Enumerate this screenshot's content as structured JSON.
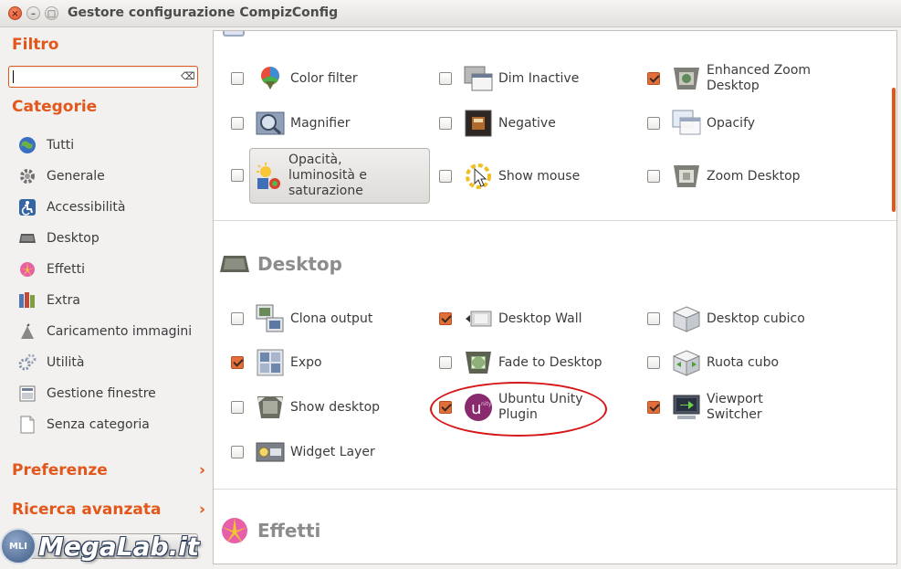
{
  "window": {
    "title": "Gestore configurazione CompizConfig"
  },
  "sidebar": {
    "filter_heading": "Filtro",
    "filter_value": "",
    "categories_heading": "Categorie",
    "categories": [
      {
        "label": "Tutti",
        "icon": "globe-icon"
      },
      {
        "label": "Generale",
        "icon": "gear-icon"
      },
      {
        "label": "Accessibilità",
        "icon": "accessibility-icon"
      },
      {
        "label": "Desktop",
        "icon": "desktop-icon"
      },
      {
        "label": "Effetti",
        "icon": "effects-icon"
      },
      {
        "label": "Extra",
        "icon": "extra-icon"
      },
      {
        "label": "Caricamento immagini",
        "icon": "image-loading-icon"
      },
      {
        "label": "Utilità",
        "icon": "utility-icon"
      },
      {
        "label": "Gestione finestre",
        "icon": "window-management-icon"
      },
      {
        "label": "Senza categoria",
        "icon": "uncategorized-icon"
      }
    ],
    "preferences_label": "Preferenze",
    "advanced_search_label": "Ricerca avanzata"
  },
  "watermark": {
    "text": "MegaLab.it",
    "logo_text": "MLI"
  },
  "accessibility_plugins": [
    {
      "label": "Color filter",
      "checked": false,
      "icon": "color-filter-icon"
    },
    {
      "label": "Dim Inactive",
      "checked": false,
      "icon": "dim-inactive-icon"
    },
    {
      "label": "Enhanced Zoom Desktop",
      "checked": true,
      "icon": "enhanced-zoom-icon"
    },
    {
      "label": "Magnifier",
      "checked": false,
      "icon": "magnifier-icon"
    },
    {
      "label": "Negative",
      "checked": false,
      "icon": "negative-icon"
    },
    {
      "label": "Opacify",
      "checked": false,
      "icon": "opacify-icon"
    },
    {
      "label": "Opacità, luminosità e saturazione",
      "checked": false,
      "icon": "opacity-brightness-icon"
    },
    {
      "label": "Show mouse",
      "checked": false,
      "icon": "show-mouse-icon"
    },
    {
      "label": "Zoom Desktop",
      "checked": false,
      "icon": "zoom-desktop-icon"
    }
  ],
  "desktop_section": {
    "heading": "Desktop",
    "plugins": [
      {
        "label": "Clona output",
        "checked": false,
        "icon": "clone-output-icon"
      },
      {
        "label": "Desktop Wall",
        "checked": true,
        "icon": "desktop-wall-icon"
      },
      {
        "label": "Desktop cubico",
        "checked": false,
        "icon": "desktop-cube-icon"
      },
      {
        "label": "Expo",
        "checked": true,
        "icon": "expo-icon"
      },
      {
        "label": "Fade to Desktop",
        "checked": false,
        "icon": "fade-to-desktop-icon"
      },
      {
        "label": "Ruota cubo",
        "checked": false,
        "icon": "rotate-cube-icon"
      },
      {
        "label": "Show desktop",
        "checked": false,
        "icon": "show-desktop-icon"
      },
      {
        "label": "Ubuntu Unity Plugin",
        "checked": true,
        "icon": "ubuntu-unity-icon"
      },
      {
        "label": "Viewport Switcher",
        "checked": true,
        "icon": "viewport-switcher-icon"
      },
      {
        "label": "Widget Layer",
        "checked": false,
        "icon": "widget-layer-icon"
      }
    ]
  },
  "effects_section": {
    "heading": "Effetti"
  },
  "colors": {
    "accent": "#e2571b",
    "checkbox_on": "#e26f3a",
    "annotation": "#d41818"
  }
}
